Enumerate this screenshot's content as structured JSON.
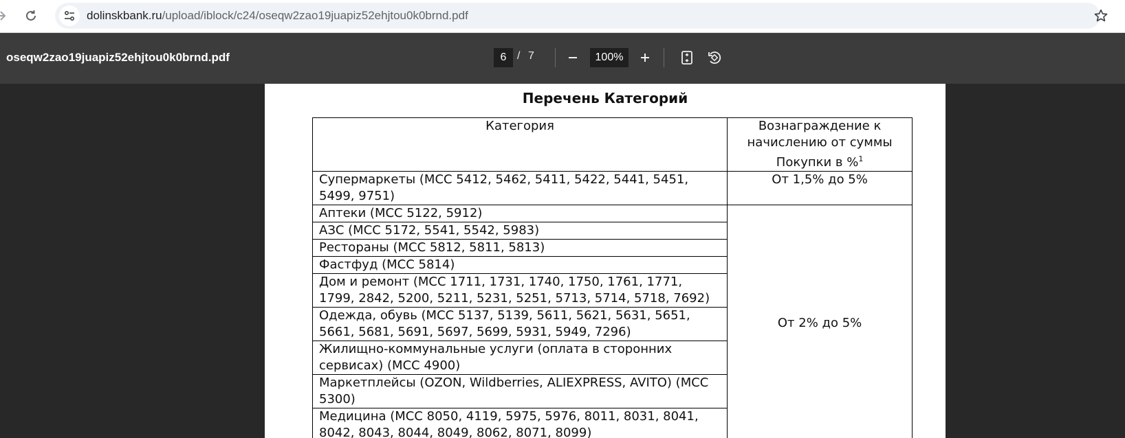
{
  "browser": {
    "url_host": "dolinskbank.ru",
    "url_path": "/upload/iblock/c24/oseqw2zao19juapiz52ehjtou0k0brnd.pdf"
  },
  "pdf_toolbar": {
    "title": "oseqw2zao19juapiz52ehjtou0k0brnd.pdf",
    "current_page": "6",
    "page_separator": "/",
    "total_pages": "7",
    "zoom": "100%"
  },
  "document": {
    "title": "Перечень Категорий",
    "header_category": "Категория",
    "header_reward": "Вознаграждение к начислению от суммы Покупки в %",
    "header_reward_sup": "1",
    "rows": [
      {
        "category": "Супермаркеты (MCC 5412, 5462, 5411, 5422, 5441, 5451, 5499, 9751)",
        "reward": "От 1,5% до 5%"
      },
      {
        "category": "Аптеки (MCC 5122, 5912)"
      },
      {
        "category": "АЗС (MCC 5172, 5541, 5542, 5983)"
      },
      {
        "category": "Рестораны (MCC 5812, 5811, 5813)"
      },
      {
        "category": "Фастфуд (MCC 5814)"
      },
      {
        "category": "Дом и ремонт (MCC 1711, 1731, 1740, 1750, 1761, 1771, 1799, 2842, 5200, 5211, 5231, 5251, 5713, 5714, 5718, 7692)"
      },
      {
        "category": "Одежда, обувь (MCC 5137, 5139, 5611, 5621, 5631, 5651, 5661, 5681, 5691, 5697, 5699, 5931, 5949, 7296)"
      },
      {
        "category": "Жилищно-коммунальные услуги (оплата в сторонних сервисах) (MCC 4900)"
      },
      {
        "category": "Маркетплейсы (OZON, Wildberries, ALIEXPRESS, AVITO) (MCC 5300)"
      },
      {
        "category": "Медицина (MCC 8050, 4119, 5975, 5976, 8011, 8031, 8041, 8042, 8043, 8044, 8049, 8062, 8071, 8099)"
      }
    ],
    "group_reward": "От 2% до 5%"
  },
  "icons": {
    "forward": "arrow-forward-icon",
    "reload": "reload-icon",
    "site_info": "tune-icon",
    "bookmark": "star-icon",
    "zoom_out": "minus-icon",
    "zoom_in": "plus-icon",
    "fit": "fit-page-icon",
    "rotate": "rotate-icon"
  }
}
